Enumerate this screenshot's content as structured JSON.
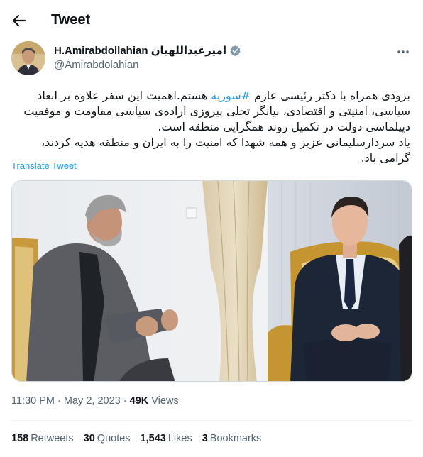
{
  "header": {
    "title": "Tweet",
    "back_icon": "arrow-left-icon"
  },
  "author": {
    "display_name": "H.Amirabdollahian امیرعبداللهیان",
    "handle": "@Amirabdolahian",
    "verified": true,
    "more_icon": "more-horizontal-icon"
  },
  "tweet": {
    "text_before_hashtag": "بزودی همراه با دکتر رئیسی عازم ",
    "hashtag": "#سوریه",
    "text_after_hashtag": " هستم.اهمیت این سفر علاوه بر ابعاد سیاسی، امنیتی و اقتصادی، بیانگر تجلی پیروزی اراده‌ی سیاسی مقاومت و موفقیت دیپلماسی دولت در تکمیل روند همگرایی منطقه است.",
    "second_paragraph": "یاد سردارسلیمانی عزیز و همه شهدا که امنیت را به ایران و منطقه هدیه کردند، گرامی باد.",
    "translate_label": "Translate Tweet"
  },
  "meta": {
    "time": "11:30 PM",
    "separator": "·",
    "date": "May 2, 2023",
    "views_count": "49K",
    "views_label": "Views"
  },
  "stats": {
    "retweets_count": "158",
    "retweets_label": "Retweets",
    "quotes_count": "30",
    "quotes_label": "Quotes",
    "likes_count": "1,543",
    "likes_label": "Likes",
    "bookmarks_count": "3",
    "bookmarks_label": "Bookmarks"
  },
  "colors": {
    "accent": "#1d9bf0",
    "text": "#0f1419",
    "muted": "#536471",
    "divider": "#eff3f4"
  }
}
